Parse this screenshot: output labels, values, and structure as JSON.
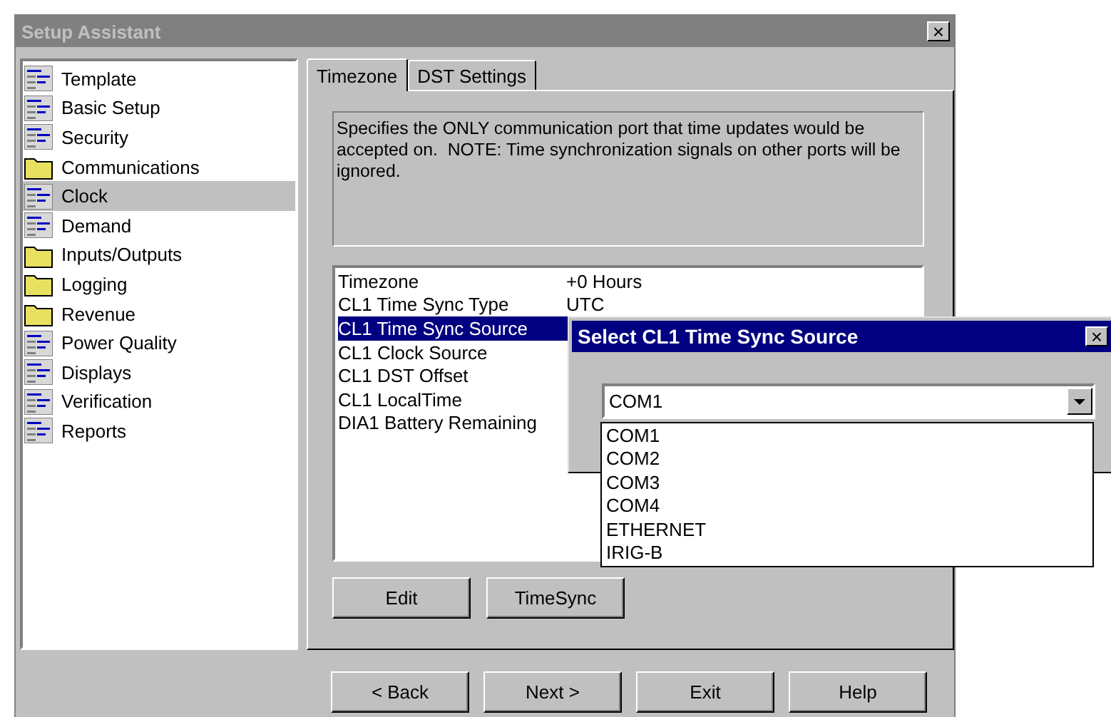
{
  "window": {
    "title": "Setup Assistant",
    "close": "×"
  },
  "sidebar": {
    "items": [
      {
        "label": "Template",
        "kind": "doc",
        "selected": false
      },
      {
        "label": "Basic Setup",
        "kind": "doc",
        "selected": false
      },
      {
        "label": "Security",
        "kind": "doc",
        "selected": false
      },
      {
        "label": "Communications",
        "kind": "folder",
        "selected": false
      },
      {
        "label": "Clock",
        "kind": "doc",
        "selected": true
      },
      {
        "label": "Demand",
        "kind": "doc",
        "selected": false
      },
      {
        "label": "Inputs/Outputs",
        "kind": "folder",
        "selected": false
      },
      {
        "label": "Logging",
        "kind": "folder",
        "selected": false
      },
      {
        "label": "Revenue",
        "kind": "folder",
        "selected": false
      },
      {
        "label": "Power Quality",
        "kind": "doc",
        "selected": false
      },
      {
        "label": "Displays",
        "kind": "doc",
        "selected": false
      },
      {
        "label": "Verification",
        "kind": "doc",
        "selected": false
      },
      {
        "label": "Reports",
        "kind": "doc",
        "selected": false
      }
    ]
  },
  "tabs": [
    {
      "label": "Timezone",
      "selected": true
    },
    {
      "label": "DST Settings",
      "selected": false
    }
  ],
  "description": "Specifies the ONLY communication port that time updates would be accepted on.  NOTE: Time synchronization signals on other ports will be ignored.",
  "settings": {
    "rows": [
      {
        "name": "Timezone",
        "value": "+0 Hours",
        "selected": false
      },
      {
        "name": "CL1 Time Sync Type",
        "value": "UTC",
        "selected": false
      },
      {
        "name": "CL1 Time Sync Source",
        "selected": true
      },
      {
        "name": "CL1 Clock Source",
        "selected": false
      },
      {
        "name": "CL1 DST Offset",
        "selected": false
      },
      {
        "name": "CL1 LocalTime",
        "selected": false
      },
      {
        "name": "DIA1 Battery Remaining",
        "selected": false
      }
    ]
  },
  "panel_buttons": [
    "Edit",
    "TimeSync"
  ],
  "nav_buttons": [
    "< Back",
    "Next >",
    "Exit",
    "Help"
  ],
  "dialog": {
    "title": "Select CL1 Time Sync Source",
    "close": "×",
    "combo": {
      "value": "COM1",
      "expanded": true
    },
    "options": [
      "COM1",
      "COM2",
      "COM3",
      "COM4",
      "ETHERNET",
      "IRIG-B"
    ]
  }
}
